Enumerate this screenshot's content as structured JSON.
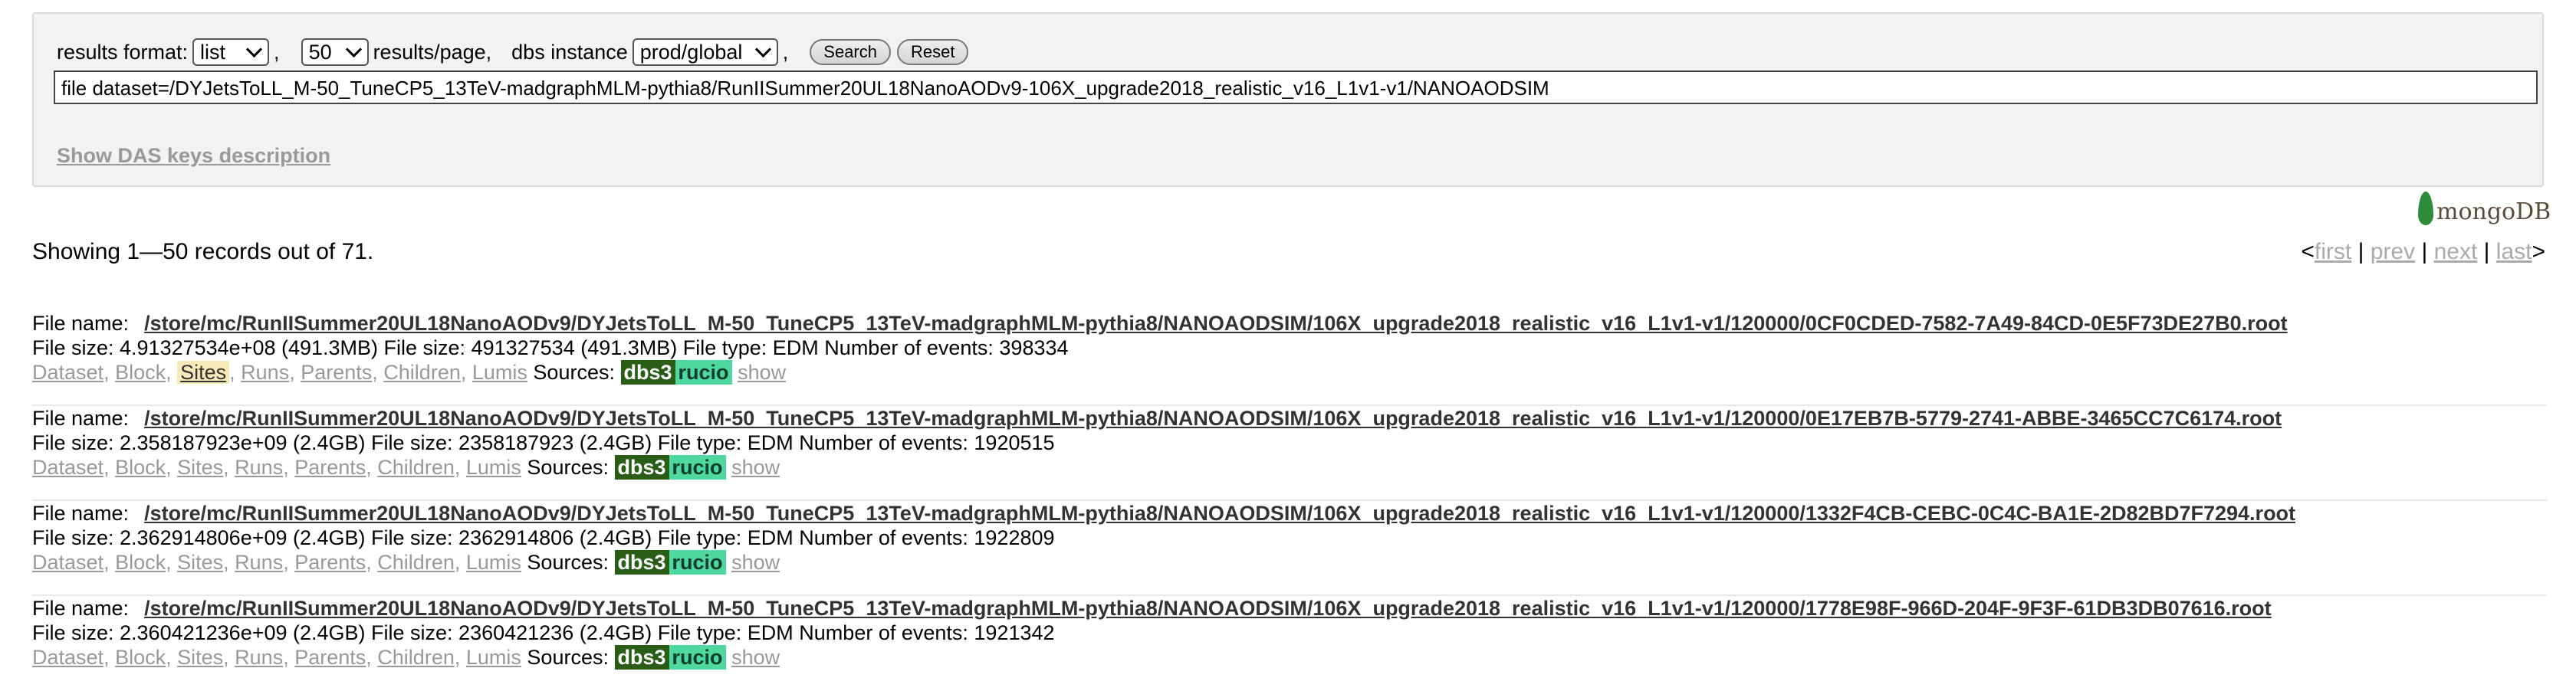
{
  "search": {
    "results_format_label": "results format:",
    "results_format_value": "list",
    "comma1": ",",
    "per_page_value": "50",
    "per_page_label": "results/page,",
    "dbs_label": "dbs instance",
    "dbs_value": "prod/global",
    "comma2": ",",
    "search_button": "Search",
    "reset_button": "Reset",
    "query": "file dataset=/DYJetsToLL_M-50_TuneCP5_13TeV-madgraphMLM-pythia8/RunIISummer20UL18NanoAODv9-106X_upgrade2018_realistic_v16_L1v1-v1/NANOAODSIM",
    "keys_link": "Show DAS keys description"
  },
  "brand": {
    "logo_text": "mongoDB"
  },
  "results": {
    "showing": "Showing 1—50 records out of 71.",
    "pager": {
      "lt": "<",
      "first": "first",
      "bar": "|",
      "prev": "prev",
      "next": "next",
      "last": "last",
      "gt": ">"
    }
  },
  "labels": {
    "file_name": "File name:",
    "sources": "Sources:",
    "links": [
      "Dataset",
      "Block",
      "Sites",
      "Runs",
      "Parents",
      "Children",
      "Lumis"
    ],
    "dbs3": "dbs3",
    "rucio": "rucio",
    "show": "show"
  },
  "records": [
    {
      "file_name": "/store/mc/RunIISummer20UL18NanoAODv9/DYJetsToLL_M-50_TuneCP5_13TeV-madgraphMLM-pythia8/NANOAODSIM/106X_upgrade2018_realistic_v16_L1v1-v1/120000/0CF0CDED-7582-7A49-84CD-0E5F73DE27B0.root",
      "details": "File size: 4.91327534e+08 (491.3MB) File size: 491327534 (491.3MB) File type: EDM Number of events: 398334"
    },
    {
      "file_name": "/store/mc/RunIISummer20UL18NanoAODv9/DYJetsToLL_M-50_TuneCP5_13TeV-madgraphMLM-pythia8/NANOAODSIM/106X_upgrade2018_realistic_v16_L1v1-v1/120000/0E17EB7B-5779-2741-ABBE-3465CC7C6174.root",
      "details": "File size: 2.358187923e+09 (2.4GB) File size: 2358187923 (2.4GB) File type: EDM Number of events: 1920515"
    },
    {
      "file_name": "/store/mc/RunIISummer20UL18NanoAODv9/DYJetsToLL_M-50_TuneCP5_13TeV-madgraphMLM-pythia8/NANOAODSIM/106X_upgrade2018_realistic_v16_L1v1-v1/120000/1332F4CB-CEBC-0C4C-BA1E-2D82BD7F7294.root",
      "details": "File size: 2.362914806e+09 (2.4GB) File size: 2362914806 (2.4GB) File type: EDM Number of events: 1922809"
    },
    {
      "file_name": "/store/mc/RunIISummer20UL18NanoAODv9/DYJetsToLL_M-50_TuneCP5_13TeV-madgraphMLM-pythia8/NANOAODSIM/106X_upgrade2018_realistic_v16_L1v1-v1/120000/1778E98F-966D-204F-9F3F-61DB3DB07616.root",
      "details": "File size: 2.360421236e+09 (2.4GB) File size: 2360421236 (2.4GB) File type: EDM Number of events: 1921342"
    }
  ]
}
